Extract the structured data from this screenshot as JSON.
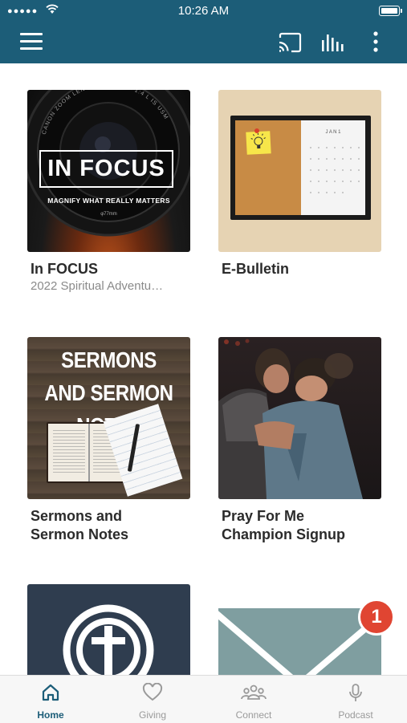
{
  "status_bar": {
    "signal": "●●●●●",
    "time": "10:26 AM"
  },
  "header": {
    "menu_icon": "hamburger-menu-icon",
    "actions": [
      "cast-icon",
      "audio-bars-icon",
      "more-vertical-icon"
    ],
    "color": "#1c5d78"
  },
  "tiles": [
    {
      "title": "In FOCUS",
      "subtitle": "2022 Spiritual Adventu…",
      "image": {
        "lens_text": "CANON ZOOM LENS EF 16-35mm 1:4 L IS USM",
        "heading": "IN FOCUS",
        "tagline": "MAGNIFY WHAT REALLY MATTERS",
        "lens_small": "φ77mm"
      }
    },
    {
      "title": "E-Bulletin",
      "image": {
        "calendar_heading": "J A N   1"
      }
    },
    {
      "title": "Sermons and Sermon Notes",
      "image": {
        "heading": "SERMONS AND SERMON NOTES"
      }
    },
    {
      "title": "Pray For Me Champion Signup"
    },
    {
      "title": ""
    },
    {
      "title": "",
      "badge": "1"
    }
  ],
  "tabbar": {
    "active": "Home",
    "items": [
      {
        "label": "Home",
        "icon": "home-icon"
      },
      {
        "label": "Giving",
        "icon": "heart-icon"
      },
      {
        "label": "Connect",
        "icon": "people-icon"
      },
      {
        "label": "Podcast",
        "icon": "microphone-icon"
      }
    ]
  }
}
